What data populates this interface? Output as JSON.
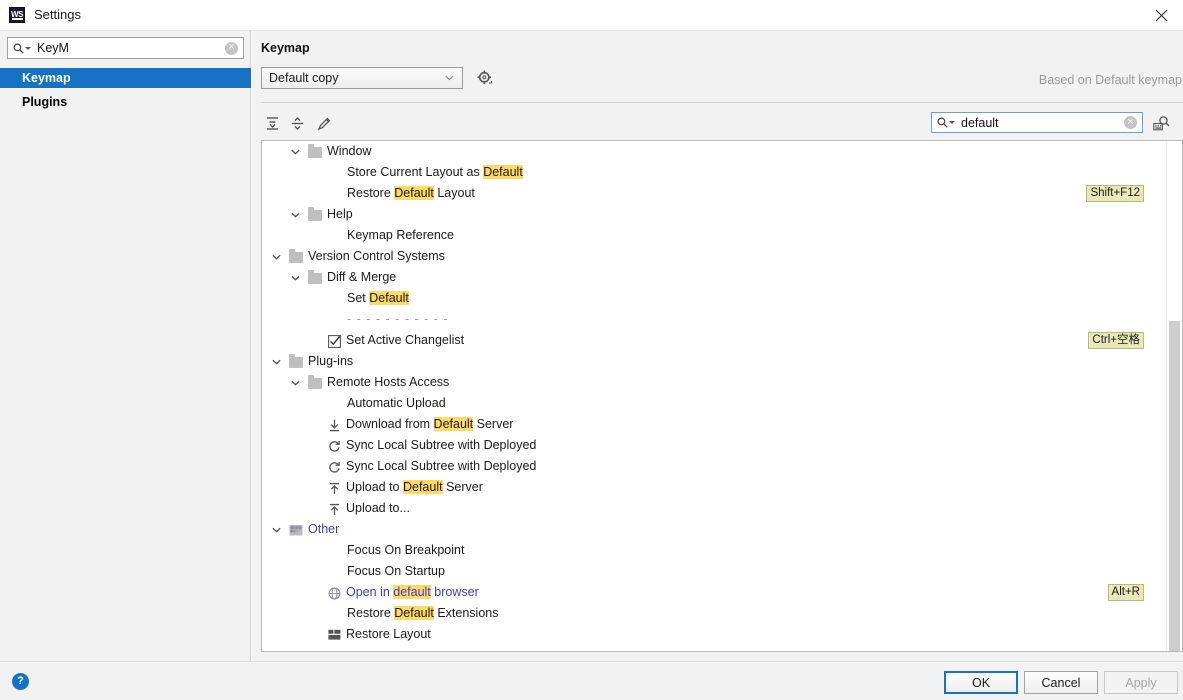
{
  "window": {
    "title": "Settings",
    "app_icon": "webstorm-ws-icon",
    "close_icon": "close-icon"
  },
  "sidebar": {
    "search": {
      "value": "KeyM",
      "placeholder": "",
      "icon": "search-icon",
      "clear_icon": "clear-icon"
    },
    "items": [
      {
        "label": "Keymap",
        "selected": true
      },
      {
        "label": "Plugins",
        "selected": false
      }
    ]
  },
  "panel": {
    "title": "Keymap",
    "keymap_select": {
      "value": "Default copy",
      "chevron": "chevron-down-icon"
    },
    "gear_label": "gear-icon",
    "based_on": "Based on Default keymap"
  },
  "toolbar": {
    "expand_all": "expand-all-icon",
    "collapse_all": "collapse-all-icon",
    "edit_shortcut": "pencil-edit-icon",
    "search": {
      "value": "default",
      "placeholder": "",
      "icon": "search-icon",
      "clear_icon": "clear-icon"
    },
    "find_by_shortcut": "find-by-shortcut-icon"
  },
  "tree": {
    "rows": [
      {
        "depth": 2,
        "twisty": "expanded",
        "icon": "folder",
        "label": "Window",
        "shortcut": ""
      },
      {
        "depth": 4,
        "twisty": "",
        "icon": "",
        "label": "Store Current Layout as ",
        "hl": "Default",
        "label2": "",
        "shortcut": ""
      },
      {
        "depth": 4,
        "twisty": "",
        "icon": "",
        "label": "Restore ",
        "hl": "Default",
        "label2": " Layout",
        "shortcut": "Shift+F12"
      },
      {
        "depth": 2,
        "twisty": "expanded",
        "icon": "folder",
        "label": "Help",
        "shortcut": ""
      },
      {
        "depth": 4,
        "twisty": "",
        "icon": "",
        "label": "Keymap Reference",
        "shortcut": ""
      },
      {
        "depth": 1,
        "twisty": "expanded",
        "icon": "folder",
        "label": "Version Control Systems",
        "shortcut": ""
      },
      {
        "depth": 2,
        "twisty": "expanded",
        "icon": "folder",
        "label": "Diff & Merge",
        "shortcut": ""
      },
      {
        "depth": 4,
        "twisty": "",
        "icon": "",
        "label": "Set ",
        "hl": "Default",
        "label2": "",
        "shortcut": ""
      },
      {
        "depth": 4,
        "twisty": "",
        "icon": "",
        "label": "- - - - - - - - - - -",
        "separator": true,
        "shortcut": ""
      },
      {
        "depth": 3,
        "twisty": "",
        "icon": "checkbox-checked-icon",
        "label": "Set Active Changelist",
        "shortcut": "Ctrl+空格"
      },
      {
        "depth": 1,
        "twisty": "expanded",
        "icon": "folder",
        "label": "Plug-ins",
        "shortcut": ""
      },
      {
        "depth": 2,
        "twisty": "expanded",
        "icon": "folder",
        "label": "Remote Hosts Access",
        "shortcut": ""
      },
      {
        "depth": 4,
        "twisty": "",
        "icon": "",
        "label": "Automatic Upload",
        "shortcut": ""
      },
      {
        "depth": 3,
        "twisty": "",
        "icon": "download-icon",
        "label": "Download from ",
        "hl": "Default",
        "label2": " Server",
        "shortcut": ""
      },
      {
        "depth": 3,
        "twisty": "",
        "icon": "sync-icon",
        "label": "Sync Local Subtree with Deployed",
        "shortcut": ""
      },
      {
        "depth": 3,
        "twisty": "",
        "icon": "sync-icon",
        "label": "Sync Local Subtree with Deployed",
        "shortcut": ""
      },
      {
        "depth": 3,
        "twisty": "",
        "icon": "upload-icon",
        "label": "Upload to ",
        "hl": "Default",
        "label2": " Server",
        "shortcut": ""
      },
      {
        "depth": 3,
        "twisty": "",
        "icon": "upload-icon",
        "label": "Upload to...",
        "shortcut": ""
      },
      {
        "depth": 1,
        "twisty": "expanded",
        "icon": "plugin-module-icon",
        "label": "Other",
        "link": true,
        "shortcut": ""
      },
      {
        "depth": 4,
        "twisty": "",
        "icon": "",
        "label": "Focus On Breakpoint",
        "shortcut": ""
      },
      {
        "depth": 4,
        "twisty": "",
        "icon": "",
        "label": "Focus On Startup",
        "shortcut": ""
      },
      {
        "depth": 3,
        "twisty": "",
        "icon": "globe-icon",
        "label": "Open in ",
        "hl": "default",
        "label2": " browser",
        "link": true,
        "shortcut": "Alt+R"
      },
      {
        "depth": 4,
        "twisty": "",
        "icon": "",
        "label": "Restore ",
        "hl": "Default",
        "label2": " Extensions",
        "shortcut": ""
      },
      {
        "depth": 3,
        "twisty": "",
        "icon": "layout-icon",
        "label": "Restore Layout",
        "shortcut": ""
      }
    ]
  },
  "footer": {
    "help_icon": "help-icon",
    "buttons": [
      {
        "label": "OK",
        "state": "default"
      },
      {
        "label": "Cancel",
        "state": "normal"
      },
      {
        "label": "Apply",
        "state": "disabled"
      }
    ]
  },
  "colors": {
    "accent": "#1572c4",
    "highlight": "#ffd966",
    "shortcut_bg": "#e8e8b8",
    "link": "#3b3bc8"
  }
}
